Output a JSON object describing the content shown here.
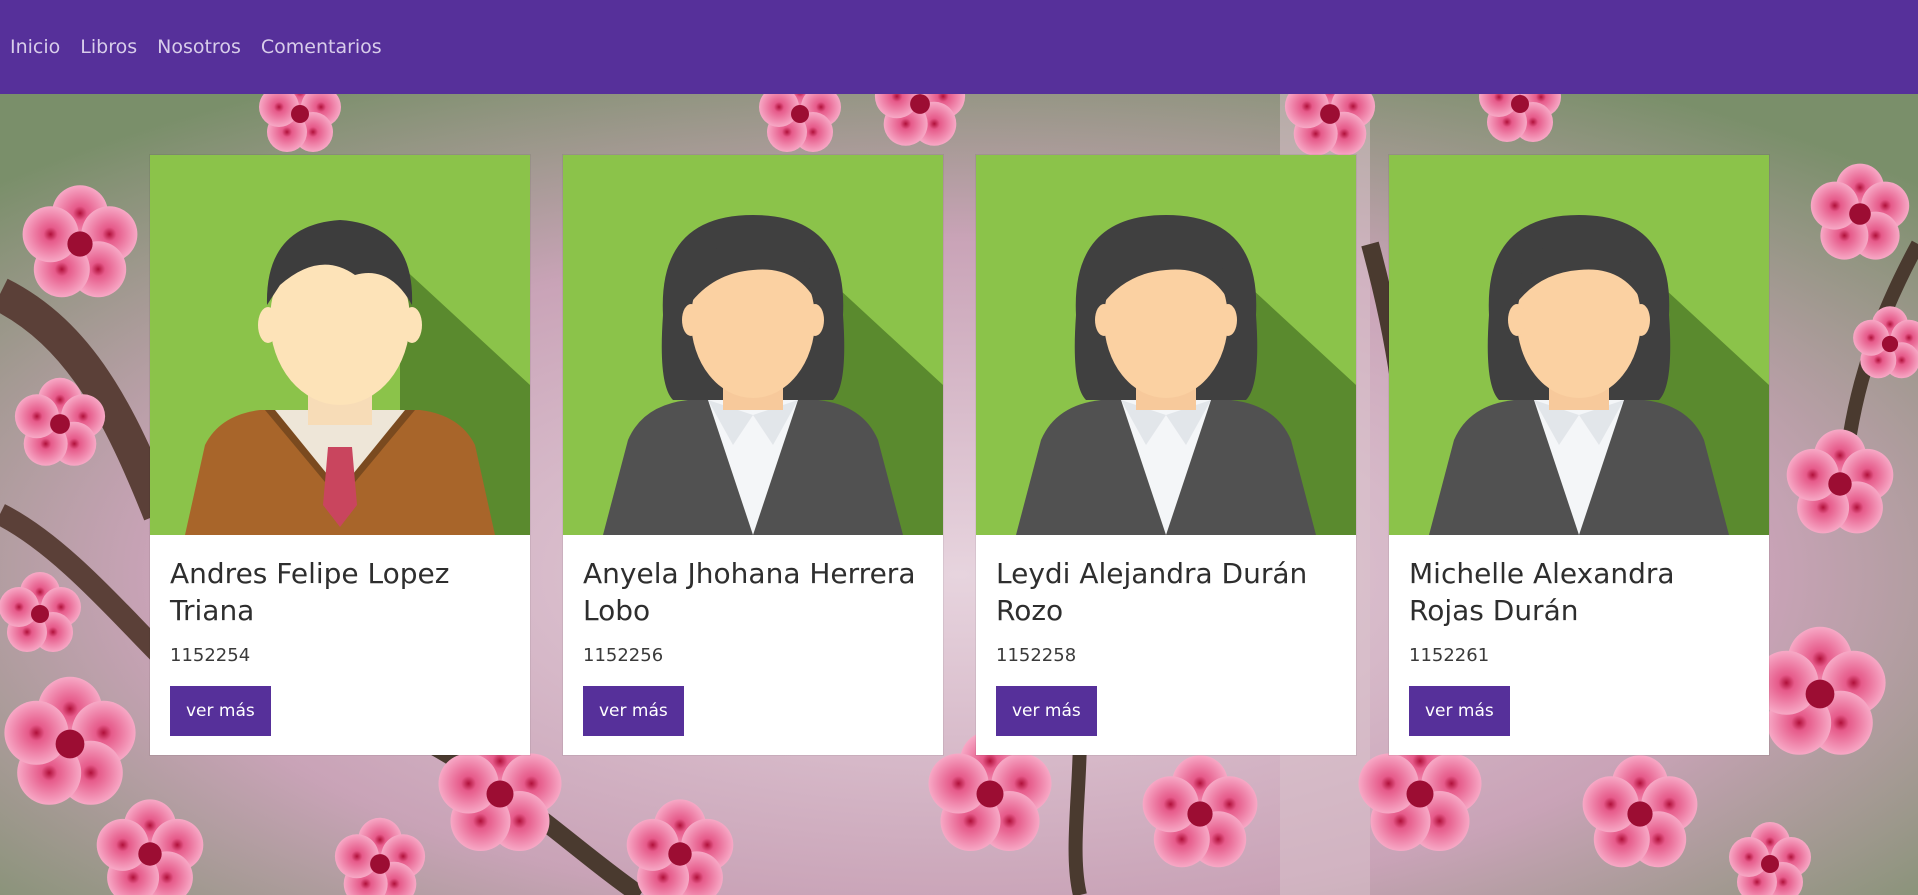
{
  "nav": {
    "items": [
      "Inicio",
      "Libros",
      "Nosotros",
      "Comentarios"
    ]
  },
  "colors": {
    "navbar": "#56309a",
    "button": "#56309a",
    "avatar_bg": "#8bc34a",
    "avatar_shadow": "#5a8a2e"
  },
  "cards": [
    {
      "name": "Andres Felipe Lopez Triana",
      "code": "1152254",
      "button": "ver más",
      "avatar": "male-avatar"
    },
    {
      "name": "Anyela Jhohana Herrera Lobo",
      "code": "1152256",
      "button": "ver más",
      "avatar": "female-avatar"
    },
    {
      "name": "Leydi Alejandra Durán Rozo",
      "code": "1152258",
      "button": "ver más",
      "avatar": "female-avatar"
    },
    {
      "name": "Michelle Alexandra Rojas Durán",
      "code": "1152261",
      "button": "ver más",
      "avatar": "female-avatar"
    }
  ]
}
